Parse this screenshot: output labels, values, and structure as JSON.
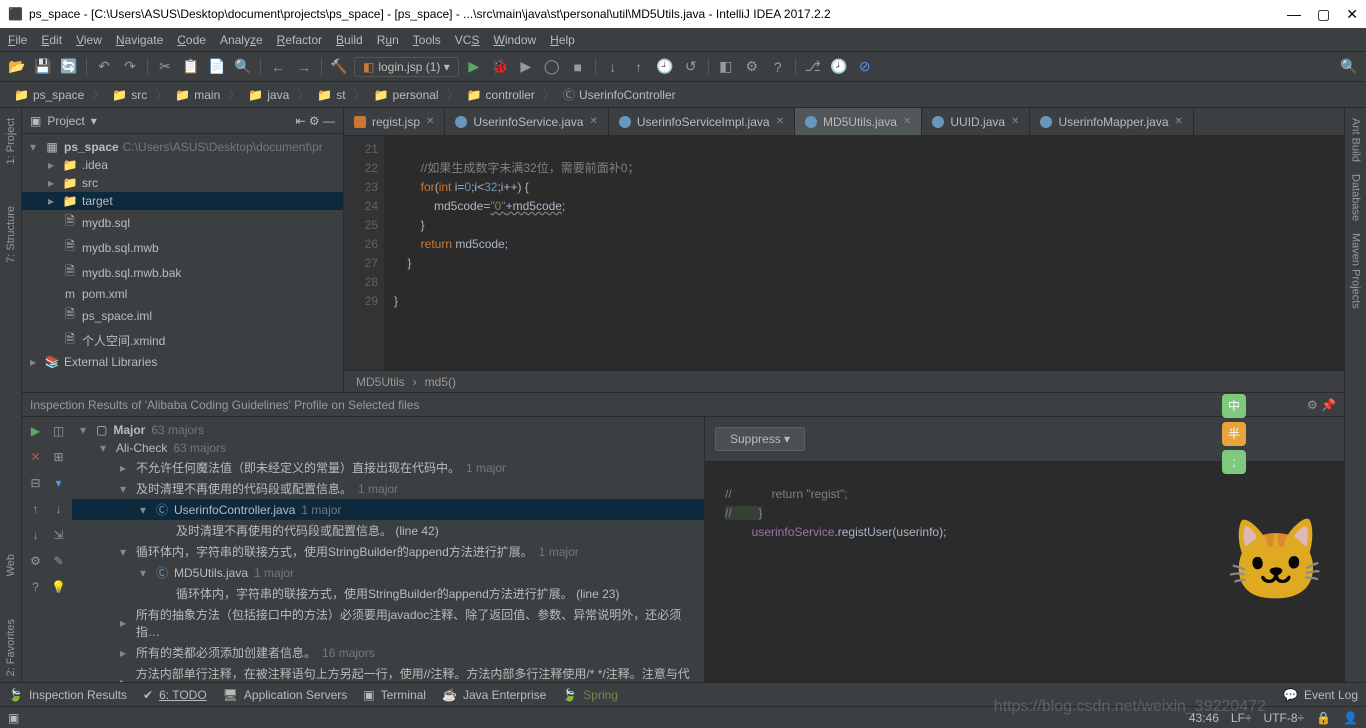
{
  "titlebar": {
    "title": "ps_space - [C:\\Users\\ASUS\\Desktop\\document\\projects\\ps_space] - [ps_space] - ...\\src\\main\\java\\st\\personal\\util\\MD5Utils.java - IntelliJ IDEA 2017.2.2"
  },
  "menu": [
    "File",
    "Edit",
    "View",
    "Navigate",
    "Code",
    "Analyze",
    "Refactor",
    "Build",
    "Run",
    "Tools",
    "VCS",
    "Window",
    "Help"
  ],
  "run_config": "login.jsp (1) ▾",
  "breadcrumb": [
    "ps_space",
    "src",
    "main",
    "java",
    "st",
    "personal",
    "controller",
    "UserinfoController"
  ],
  "project_header": "Project",
  "project_tree": {
    "root": {
      "label": "ps_space",
      "path": "C:\\Users\\ASUS\\Desktop\\document\\pr"
    },
    "items": [
      {
        "indent": 1,
        "arrow": "▸",
        "icon": "📁",
        "label": ".idea",
        "folder": true
      },
      {
        "indent": 1,
        "arrow": "▸",
        "icon": "📁",
        "label": "src",
        "folder": true
      },
      {
        "indent": 1,
        "arrow": "▸",
        "icon": "📁",
        "label": "target",
        "folder": true,
        "sel": true
      },
      {
        "indent": 1,
        "arrow": " ",
        "icon": "🗎",
        "label": "mydb.sql"
      },
      {
        "indent": 1,
        "arrow": " ",
        "icon": "🗎",
        "label": "mydb.sql.mwb"
      },
      {
        "indent": 1,
        "arrow": " ",
        "icon": "🗎",
        "label": "mydb.sql.mwb.bak"
      },
      {
        "indent": 1,
        "arrow": " ",
        "icon": "m",
        "label": "pom.xml"
      },
      {
        "indent": 1,
        "arrow": " ",
        "icon": "🗎",
        "label": "ps_space.iml"
      },
      {
        "indent": 1,
        "arrow": " ",
        "icon": "🗎",
        "label": "个人空间.xmind"
      }
    ],
    "external": "External Libraries"
  },
  "editor_tabs": [
    {
      "label": "regist.jsp",
      "active": false,
      "icon": "j"
    },
    {
      "label": "UserinfoService.java",
      "active": false,
      "icon": "c"
    },
    {
      "label": "UserinfoServiceImpl.java",
      "active": false,
      "icon": "c"
    },
    {
      "label": "MD5Utils.java",
      "active": true,
      "icon": "c"
    },
    {
      "label": "UUID.java",
      "active": false,
      "icon": "c"
    },
    {
      "label": "UserinfoMapper.java",
      "active": false,
      "icon": "c"
    }
  ],
  "line_numbers": [
    "21",
    "22",
    "23",
    "24",
    "25",
    "26",
    "27",
    "28",
    "29"
  ],
  "code_lines": {
    "c21": "        //如果生成数字未满32位，需要前面补0；",
    "c22a": "        ",
    "c22b": "for",
    "c22c": "(",
    "c22d": "int",
    "c22e": " i=",
    "c22f": "0",
    "c22g": ";i<",
    "c22h": "32",
    "c22i": ";i++) {",
    "c23a": "            md5code=",
    "c23b": "\"0\"",
    "c23c": "+md5code",
    "c24": "        }",
    "c25a": "        ",
    "c25b": "return",
    "c25c": " md5code;",
    "c26": "    }",
    "c27": "",
    "c28": "}",
    "c29": ""
  },
  "editor_breadcrumb": [
    "MD5Utils",
    "md5()"
  ],
  "inspection": {
    "title": "Inspection Results of 'Alibaba Coding Guidelines' Profile on Selected files",
    "suppress": "Suppress ▾",
    "tree": [
      {
        "lvl": 0,
        "arr": "▾",
        "label": "Major",
        "count": "63 majors",
        "box": true
      },
      {
        "lvl": 1,
        "arr": "▾",
        "label": "Ali-Check",
        "count": "63 majors"
      },
      {
        "lvl": 2,
        "arr": "▸",
        "label": "不允许任何魔法值（即未经定义的常量）直接出现在代码中。",
        "count": "1 major"
      },
      {
        "lvl": 2,
        "arr": "▾",
        "label": "及时清理不再使用的代码段或配置信息。",
        "count": "1 major"
      },
      {
        "lvl": 3,
        "arr": "▾",
        "label": "UserinfoController.java",
        "count": "1 major",
        "icon": "c",
        "sel": true
      },
      {
        "lvl": 4,
        "arr": " ",
        "label": "及时清理不再使用的代码段或配置信息。  (line 42)"
      },
      {
        "lvl": 2,
        "arr": "▾",
        "label": "循环体内，字符串的联接方式，使用StringBuilder的append方法进行扩展。",
        "count": "1 major"
      },
      {
        "lvl": 3,
        "arr": "▾",
        "label": "MD5Utils.java",
        "count": "1 major",
        "icon": "c"
      },
      {
        "lvl": 4,
        "arr": " ",
        "label": "循环体内，字符串的联接方式，使用StringBuilder的append方法进行扩展。  (line 23)"
      },
      {
        "lvl": 2,
        "arr": "▸",
        "label": "所有的抽象方法（包括接口中的方法）必须要用javadoc注释、除了返回值、参数、异常说明外，还必须指…"
      },
      {
        "lvl": 2,
        "arr": "▸",
        "label": "所有的类都必须添加创建者信息。",
        "count": "16 majors"
      },
      {
        "lvl": 2,
        "arr": "▸",
        "label": "方法内部单行注释，在被注释语句上方另起一行，使用//注释。方法内部多行注释使用/* */注释。注意与代码…"
      }
    ],
    "snippet": {
      "l1": "//            return \"regist\";",
      "l2": "//        }",
      "l3": "        userinfoService.registUser(userinfo);"
    }
  },
  "bottom_tabs": [
    "Inspection Results",
    "6: TODO",
    "Application Servers",
    "Terminal",
    "Java Enterprise",
    "Spring"
  ],
  "event_log": "Event Log",
  "status": {
    "pos": "43:46",
    "lf": "LF÷",
    "enc": "UTF-8÷",
    "lock": "🔒"
  },
  "watermark": "https://blog.csdn.net/weixin_39220472",
  "left_tools": [
    "1: Project",
    "7: Structure"
  ],
  "right_tools": [
    "Ant Build",
    "Database",
    "Maven Projects"
  ],
  "fav_web": [
    "Web",
    "2: Favorites"
  ]
}
